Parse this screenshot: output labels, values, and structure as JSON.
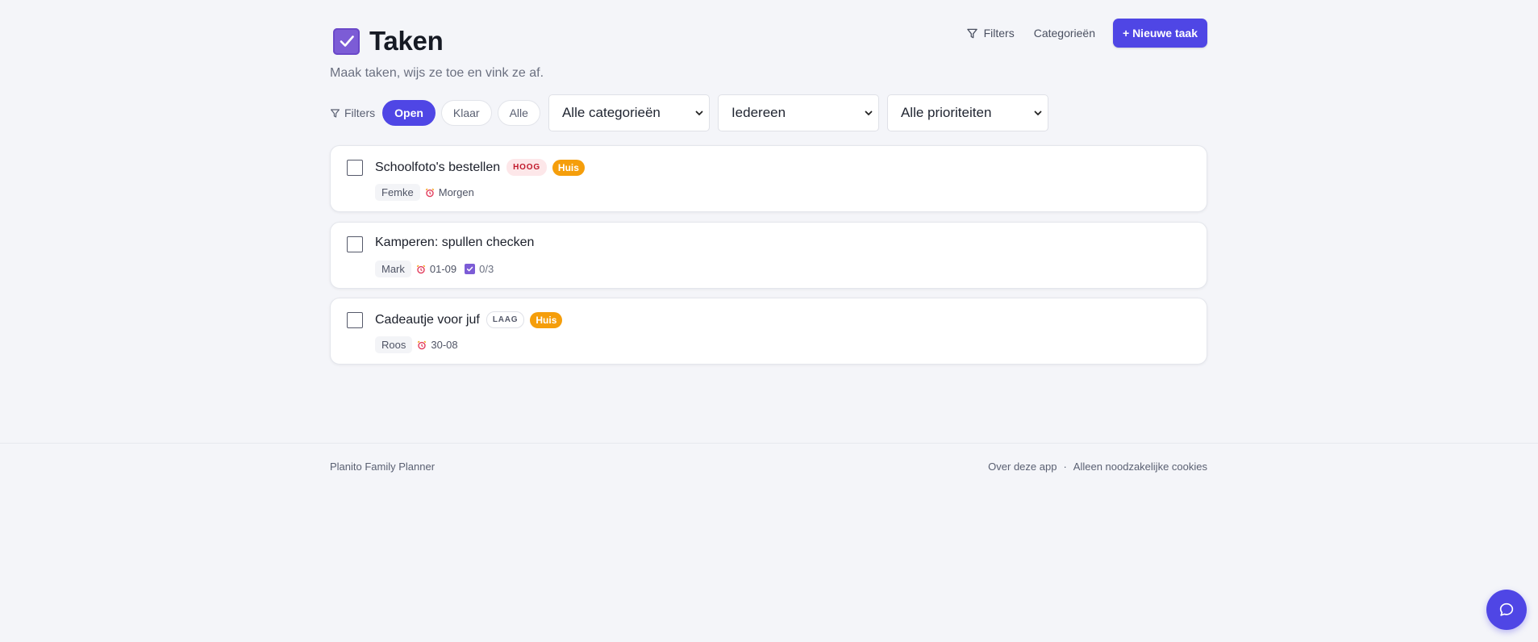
{
  "header": {
    "title": "Taken",
    "subtitle": "Maak taken, wijs ze toe en vink ze af.",
    "filters_label": "Filters",
    "categories_label": "Categorieën",
    "new_task_label": "+ Nieuwe taak"
  },
  "filters": {
    "label": "Filters",
    "status_pills": [
      "Open",
      "Klaar",
      "Alle"
    ],
    "active_pill": "Open",
    "category_select": "Alle categorieën",
    "person_select": "Iedereen",
    "priority_select": "Alle prioriteiten"
  },
  "tasks": [
    {
      "title": "Schoolfoto's bestellen",
      "priority": "HOOG",
      "category": "Huis",
      "assignee": "Femke",
      "due": "Morgen",
      "checked": false
    },
    {
      "title": "Kamperen: spullen checken",
      "assignee": "Mark",
      "due": "01-09",
      "subtasks": "0/3",
      "checked": false
    },
    {
      "title": "Cadeautje voor juf",
      "priority": "LAAG",
      "category": "Huis",
      "assignee": "Roos",
      "due": "30-08",
      "checked": false
    }
  ],
  "footer": {
    "app_name": "Planito Family Planner",
    "about_link": "Over deze app",
    "separator": "·",
    "cookies_link": "Alleen noodzakelijke cookies"
  },
  "colors": {
    "accent": "#4f46e5",
    "brand_purple": "#7c5cd6",
    "category_orange": "#f59e0b",
    "priority_high_text": "#c0182a"
  },
  "icons": {
    "title": "checkbox-checked-icon",
    "filter": "funnel-icon",
    "due": "alarm-clock-icon",
    "subtasks": "checkbox-checked-icon",
    "chat": "chat-bubble-icon"
  }
}
